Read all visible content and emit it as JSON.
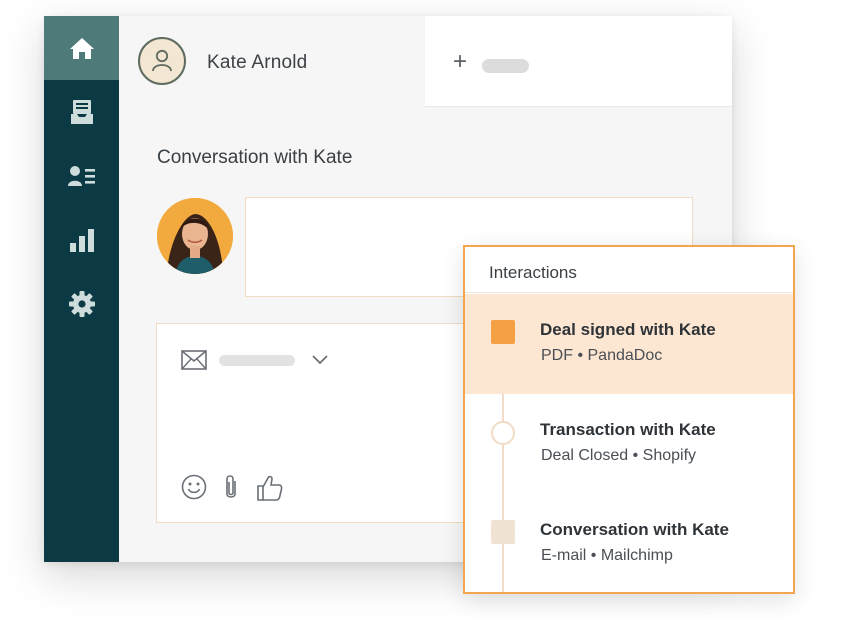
{
  "sidebar": {
    "items": [
      {
        "icon": "home-icon",
        "active": true
      },
      {
        "icon": "inbox-icon",
        "active": false
      },
      {
        "icon": "contacts-icon",
        "active": false
      },
      {
        "icon": "reports-icon",
        "active": false
      },
      {
        "icon": "settings-icon",
        "active": false
      }
    ]
  },
  "header": {
    "contact_name": "Kate Arnold",
    "add_tab_label": "+"
  },
  "conversation": {
    "title": "Conversation with Kate"
  },
  "composer": {
    "icons": [
      "mail-icon",
      "chevron-down-icon",
      "emoji-icon",
      "attachment-icon",
      "thumbs-up-icon"
    ]
  },
  "interactions": {
    "title": "Interactions",
    "items": [
      {
        "title": "Deal signed with Kate",
        "subtitle": "PDF • PandaDoc"
      },
      {
        "title": "Transaction with Kate",
        "subtitle": "Deal Closed • Shopify"
      },
      {
        "title": "Conversation with Kate",
        "subtitle": "E-mail • Mailchimp"
      }
    ]
  },
  "colors": {
    "sidebar": "#0b3a44",
    "sidebar_active": "#4f7a7a",
    "accent": "#f3a64f",
    "highlight": "#fde7d2"
  }
}
